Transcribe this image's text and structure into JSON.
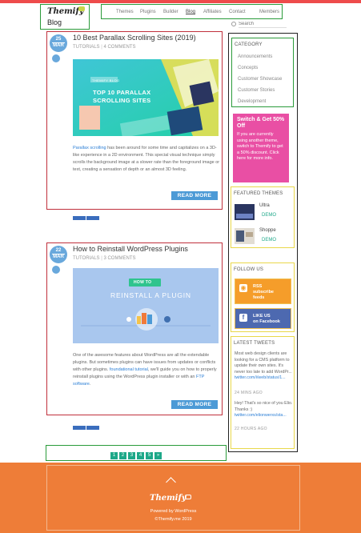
{
  "header": {
    "logo": "Themify",
    "blog_label": "Blog",
    "nav": [
      "Themes",
      "Plugins",
      "Builder",
      "Blog",
      "Affiliates",
      "Contact",
      "Members"
    ],
    "active_nav": "Blog",
    "search_placeholder": "Search"
  },
  "posts": [
    {
      "day": "25",
      "month": "MAR",
      "title": "10 Best Parallax Scrolling Sites (2019)",
      "category": "TUTORIALS",
      "comments": "4 COMMENTS",
      "image_badge": "THEMIFY BLOG",
      "image_title_line1": "TOP 10 PARALLAX",
      "image_title_line2": "SCROLLING SITES",
      "excerpt_link": "Parallax scrolling",
      "excerpt": " has been around for some time and capitalizes on a 3D-like experience in a 2D environment. This special visual technique simply scrolls the background image at a slower rate than the foreground image or text, creating a sensation of depth or an almost 3D feeling.",
      "read_more": "READ MORE"
    },
    {
      "day": "22",
      "month": "MAR",
      "title": "How to Reinstall WordPress Plugins",
      "category": "TUTORIALS",
      "comments": "3 COMMENTS",
      "image_badge": "HOW TO",
      "image_title": "REINSTALL A PLUGIN",
      "excerpt_a": "One of the awesome features about WordPress are all the extendable plugins. But sometimes plugins can have issues from updates or conflicts with other plugins. ",
      "excerpt_link1": "foundational tutorial",
      "excerpt_b": ", we'll guide you on how to properly reinstall plugins using the WordPress plugin installer or with an ",
      "excerpt_link2": "FTP software",
      "excerpt_c": ".",
      "read_more": "READ MORE"
    }
  ],
  "pagination": [
    "1",
    "2",
    "3",
    "4",
    "5",
    "»"
  ],
  "sidebar": {
    "category_title": "CATEGORY",
    "categories": [
      "Announcements",
      "Concepts",
      "Customer Showcase",
      "Customer Stories",
      "Development"
    ],
    "promo_title": "Switch & Get 50% Off",
    "promo_body": "If you are currently using another theme, switch to Themify to get a 50% discount. Click here for more info.",
    "featured_title": "FEATURED THEMES",
    "themes": [
      {
        "name": "Ultra",
        "demo": "DEMO"
      },
      {
        "name": "Shoppe",
        "demo": "DEMO"
      }
    ],
    "follow_title": "FOLLOW US",
    "rss_label_1": "RSS",
    "rss_label_2": "subscribe",
    "rss_label_3": "feeds",
    "fb_label_1": "LIKE US",
    "fb_label_2": "on Facebook",
    "tweets_title": "LATEST TWEETS",
    "tweets": [
      {
        "text": "Most web design clients are looking for a CMS platform to update their own sites. It's never too late to add WordPr...",
        "link": "twitter.com/i/web/status/1...",
        "time": "24 MINS AGO"
      },
      {
        "text": "Hey! That's so nice of you Elio. Thanks :) ",
        "link": "twitter.com/elionwerxs/sta...",
        "time": "22 HOURS AGO"
      }
    ]
  },
  "footer": {
    "logo": "Themify",
    "powered": "Powered by WordPress",
    "copyright": "©Themify.me 2019"
  },
  "colors": {
    "accent_red": "#ee4b4b",
    "date_blue": "#69a8dc",
    "pager_teal": "#1ea889",
    "promo_pink": "#e94fa4",
    "footer_orange": "#ee7d38"
  }
}
